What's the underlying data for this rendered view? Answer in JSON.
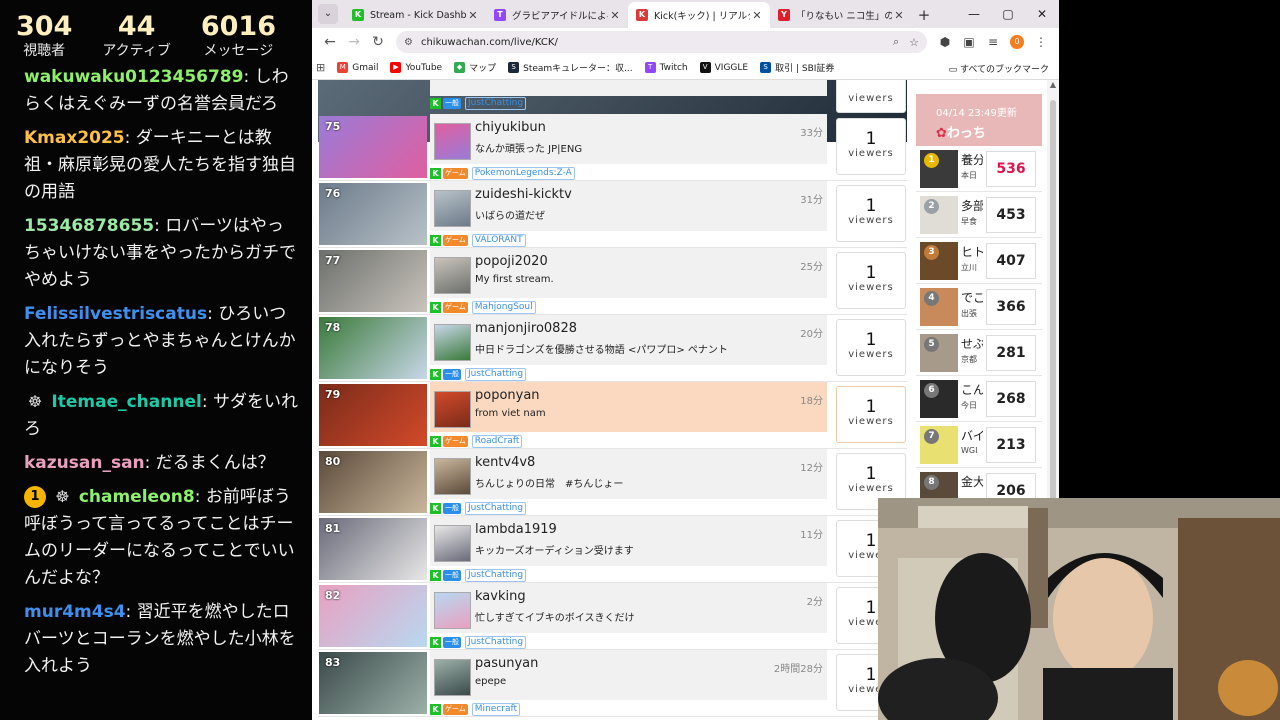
{
  "chat": {
    "stats": [
      {
        "value": "304",
        "label": "視聴者"
      },
      {
        "value": "44",
        "label": "アクティブ"
      },
      {
        "value": "6016",
        "label": "メッセージ"
      }
    ],
    "messages": [
      {
        "user": "wakuwaku0123456789",
        "color": "#8ef06a",
        "text": ": しわらくはえぐみーずの名誉会員だろ"
      },
      {
        "user": "Kmax2025",
        "color": "#ffc048",
        "text": ": ダーキニーとは教祖・麻原彰晃の愛人たちを指す独自の用語"
      },
      {
        "user": "15346878655",
        "color": "#9de8a6",
        "text": ": ロバーツはやっちゃいけない事をやったからガチでやめよう"
      },
      {
        "user": "Felissilvestriscatus",
        "color": "#3f8fef",
        "text": ": ひろいつ入れたらずっとやまちゃんとけんかになりそう"
      },
      {
        "user": "Itemae_channel",
        "color": "#1fc9a8",
        "text": ": サダをいれろ",
        "badge_icon": "ninja"
      },
      {
        "user": "kazusan_san",
        "color": "#e8a0bc",
        "text": ": だるまくんは？"
      },
      {
        "user": "chameleon8",
        "color": "#8ef06a",
        "text": ": お前呼ぼう呼ぼうって言ってるってことはチームのリーダーになるってことでいいんだよな？",
        "badge_num": "1",
        "badge_icon": "ninja"
      },
      {
        "user": "mur4m4s4",
        "color": "#3f8fef",
        "text": ": 習近平を燃やしたロバーツとコーランを燃やした小林を入れよう"
      }
    ]
  },
  "browser": {
    "tabs": [
      {
        "label": "Stream - Kick Dashboard",
        "fav_color": "#1fbf2a",
        "fav_text": "K"
      },
      {
        "label": "グラビアアイドルによる雑談配信",
        "fav_color": "#9146ff",
        "fav_text": "T"
      },
      {
        "label": "Kick(キック) | リアルタイムラン",
        "fav_color": "#d93a3a",
        "fav_text": "K"
      },
      {
        "label": "「りなもい ニコ生」の検索結果",
        "fav_color": "#e01e2b",
        "fav_text": "Y"
      }
    ],
    "url": "chikuwachan.com/live/KCK/",
    "profile_initial": "0",
    "bookmarks": [
      {
        "label": "Gmail",
        "color": "#ea4335",
        "icon": "M"
      },
      {
        "label": "YouTube",
        "color": "#ff0000",
        "icon": "▶"
      },
      {
        "label": "マップ",
        "color": "#34a853",
        "icon": "◆"
      },
      {
        "label": "Steamキュレーター：収...",
        "color": "#1b2838",
        "icon": "S"
      },
      {
        "label": "Twitch",
        "color": "#9146ff",
        "icon": "T"
      },
      {
        "label": "VIGGLE",
        "color": "#111111",
        "icon": "V"
      },
      {
        "label": "取引 | SBI証券",
        "color": "#0050a0",
        "icon": "S"
      }
    ],
    "bookmarks_all": "すべてのブックマーク"
  },
  "list": {
    "top_partial_tag": "JustChatting",
    "rows": [
      {
        "rank": "75",
        "name": "chiyukibun",
        "title": "なんか頑張った JP|ENG",
        "elapsed": "33分",
        "cat": "ゲーム",
        "cat_type": "game",
        "game": "PokemonLegends:Z-A",
        "viewers": "1"
      },
      {
        "rank": "76",
        "name": "zuideshi-kicktv",
        "title": "いばらの道だぜ",
        "elapsed": "31分",
        "cat": "ゲーム",
        "cat_type": "game",
        "game": "VALORANT",
        "viewers": "1"
      },
      {
        "rank": "77",
        "name": "popoji2020",
        "title": "My first stream.",
        "elapsed": "25分",
        "cat": "ゲーム",
        "cat_type": "game",
        "game": "MahjongSoul",
        "viewers": "1"
      },
      {
        "rank": "78",
        "name": "manjonjiro0828",
        "title": "中日ドラゴンズを優勝させる物語 <パワプロ> ペナント",
        "elapsed": "20分",
        "cat": "一般",
        "cat_type": "chat",
        "game": "JustChatting",
        "viewers": "1"
      },
      {
        "rank": "79",
        "name": "poponyan",
        "title": "from viet nam",
        "elapsed": "18分",
        "cat": "ゲーム",
        "cat_type": "game",
        "game": "RoadCraft",
        "viewers": "1",
        "highlight": true
      },
      {
        "rank": "80",
        "name": "kentv4v8",
        "title": "ちんじょりの日常　#ちんじょー",
        "elapsed": "12分",
        "cat": "一般",
        "cat_type": "chat",
        "game": "JustChatting",
        "viewers": "1"
      },
      {
        "rank": "81",
        "name": "lambda1919",
        "title": "キッカーズオーディション受けます",
        "elapsed": "11分",
        "cat": "一般",
        "cat_type": "chat",
        "game": "JustChatting",
        "viewers": "1"
      },
      {
        "rank": "82",
        "name": "kavking",
        "title": "忙しすぎてイブキのボイスきくだけ",
        "elapsed": "2分",
        "cat": "一般",
        "cat_type": "chat",
        "game": "JustChatting",
        "viewers": "1"
      },
      {
        "rank": "83",
        "name": "pasunyan",
        "title": "epepe",
        "elapsed": "2時間28分",
        "cat": "ゲーム",
        "cat_type": "game",
        "game": "Minecraft",
        "viewers": "1"
      }
    ],
    "viewers_label": "viewers",
    "k_label": "K"
  },
  "ranking": {
    "updated": "04/14 23:49更新",
    "title": "わっち",
    "items": [
      {
        "rank": "1",
        "name": "養分",
        "sub": "本日",
        "count": "536",
        "badge_color": "#e6b800",
        "top": true
      },
      {
        "rank": "2",
        "name": "多部",
        "sub": "早食",
        "count": "453",
        "badge_color": "#9aa0a6"
      },
      {
        "rank": "3",
        "name": "ヒト",
        "sub": "立川",
        "count": "407",
        "badge_color": "#c07a3a"
      },
      {
        "rank": "4",
        "name": "でこ",
        "sub": "出張",
        "count": "366",
        "badge_color": "#777777"
      },
      {
        "rank": "5",
        "name": "せぶ",
        "sub": "京都",
        "count": "281",
        "badge_color": "#777777"
      },
      {
        "rank": "6",
        "name": "こん",
        "sub": "今日",
        "count": "268",
        "badge_color": "#777777"
      },
      {
        "rank": "7",
        "name": "バイ",
        "sub": "WGI",
        "count": "213",
        "badge_color": "#777777"
      },
      {
        "rank": "8",
        "name": "金大",
        "sub": "",
        "count": "206",
        "badge_color": "#777777"
      }
    ]
  }
}
